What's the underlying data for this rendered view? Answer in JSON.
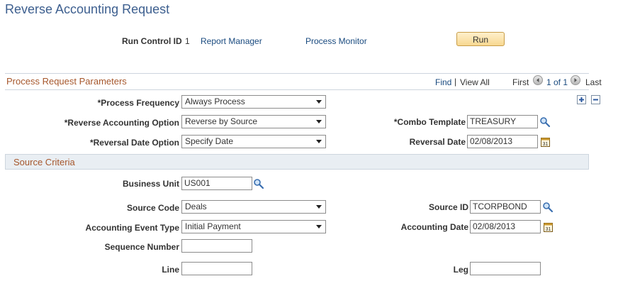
{
  "page": {
    "title": "Reverse Accounting Request"
  },
  "run_control": {
    "label": "Run Control ID",
    "value": "1",
    "report_manager": "Report Manager",
    "process_monitor": "Process Monitor",
    "run_button": "Run"
  },
  "params": {
    "title": "Process Request Parameters",
    "find": "Find",
    "separator": "|",
    "view_all": "View All",
    "first": "First",
    "count": "1 of 1",
    "last": "Last",
    "add_row": "+",
    "delete_row": "−",
    "process_frequency": {
      "label": "*Process Frequency",
      "value": "Always Process"
    },
    "reverse_accounting_option": {
      "label": "*Reverse Accounting Option",
      "value": "Reverse by Source"
    },
    "reversal_date_option": {
      "label": "*Reversal Date Option",
      "value": "Specify Date"
    },
    "combo_template": {
      "label": "*Combo Template",
      "value": "TREASURY"
    },
    "reversal_date": {
      "label": "Reversal Date",
      "value": "02/08/2013"
    }
  },
  "source": {
    "title": "Source Criteria",
    "business_unit": {
      "label": "Business Unit",
      "value": "US001"
    },
    "source_code": {
      "label": "Source Code",
      "value": "Deals"
    },
    "accounting_event_type": {
      "label": "Accounting Event Type",
      "value": "Initial Payment"
    },
    "sequence_number": {
      "label": "Sequence Number",
      "value": ""
    },
    "line": {
      "label": "Line",
      "value": ""
    },
    "source_id": {
      "label": "Source ID",
      "value": "TCORPBOND"
    },
    "accounting_date": {
      "label": "Accounting Date",
      "value": "02/08/2013"
    },
    "leg": {
      "label": "Leg",
      "value": ""
    }
  },
  "colors": {
    "title": "#3d5f8f",
    "section_title": "#a6572c",
    "link": "#194a7f",
    "section_bg": "#e9eef3",
    "run_button_bg": "#f7d891"
  }
}
